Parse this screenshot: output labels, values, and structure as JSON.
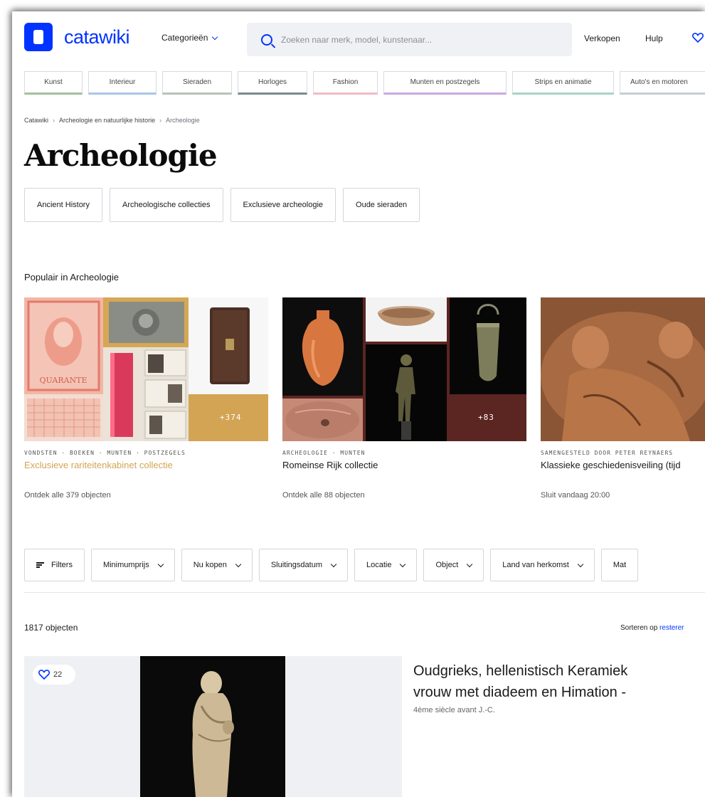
{
  "header": {
    "brand": "catawiki",
    "categories_label": "Categorieën",
    "search_placeholder": "Zoeken naar merk, model, kunstenaar...",
    "sell_label": "Verkopen",
    "help_label": "Hulp"
  },
  "categories": [
    {
      "label": "Kunst",
      "color": "#9fc29a"
    },
    {
      "label": "Interieur",
      "color": "#a9c6e8"
    },
    {
      "label": "Sieraden",
      "color": "#b9c2b7"
    },
    {
      "label": "Horloges",
      "color": "#7a8a8a"
    },
    {
      "label": "Fashion",
      "color": "#f2b9c7"
    },
    {
      "label": "Munten en postzegels",
      "color": "#c9a9e0"
    },
    {
      "label": "Strips en animatie",
      "color": "#a7d3c5"
    },
    {
      "label": "Auto's en motoren",
      "color": "#c8ccd2"
    }
  ],
  "breadcrumb": [
    "Catawiki",
    "Archeologie en natuurlijke historie",
    "Archeologie"
  ],
  "page_title": "Archeologie",
  "subcategories": [
    "Ancient History",
    "Archeologische collecties",
    "Exclusieve archeologie",
    "Oude sieraden"
  ],
  "popular_title": "Populair in Archeologie",
  "collections": [
    {
      "tag": "VONDSTEN · BOEKEN · MUNTEN · POSTZEGELS",
      "name": "Exclusieve rariteitenkabinet collectie",
      "cta": "Ontdek alle 379 objecten",
      "extra": "+374"
    },
    {
      "tag": "ARCHEOLOGIE · MUNTEN",
      "name": "Romeinse Rijk collectie",
      "cta": "Ontdek alle 88 objecten",
      "extra": "+83"
    },
    {
      "tag": "SAMENGESTELD DOOR PETER REYNAERS",
      "name": "Klassieke geschiedenisveiling (tijd",
      "cta": "Sluit vandaag 20:00"
    }
  ],
  "filters": {
    "filters_label": "Filters",
    "items": [
      "Minimumprijs",
      "Nu kopen",
      "Sluitingsdatum",
      "Locatie",
      "Object",
      "Land van herkomst",
      "Mat"
    ]
  },
  "results": {
    "count": "1817 objecten",
    "sort_label": "Sorteren op",
    "sort_value": "resterer"
  },
  "lot": {
    "favorites": "22",
    "title_line1": "Oudgrieks, hellenistisch Keramiek",
    "title_line2": "vrouw met diadeem en Himation -",
    "subtitle": "4ème siècle avant J.-C."
  },
  "colors": {
    "brand": "#0033ff",
    "accent": "#d3a454"
  }
}
